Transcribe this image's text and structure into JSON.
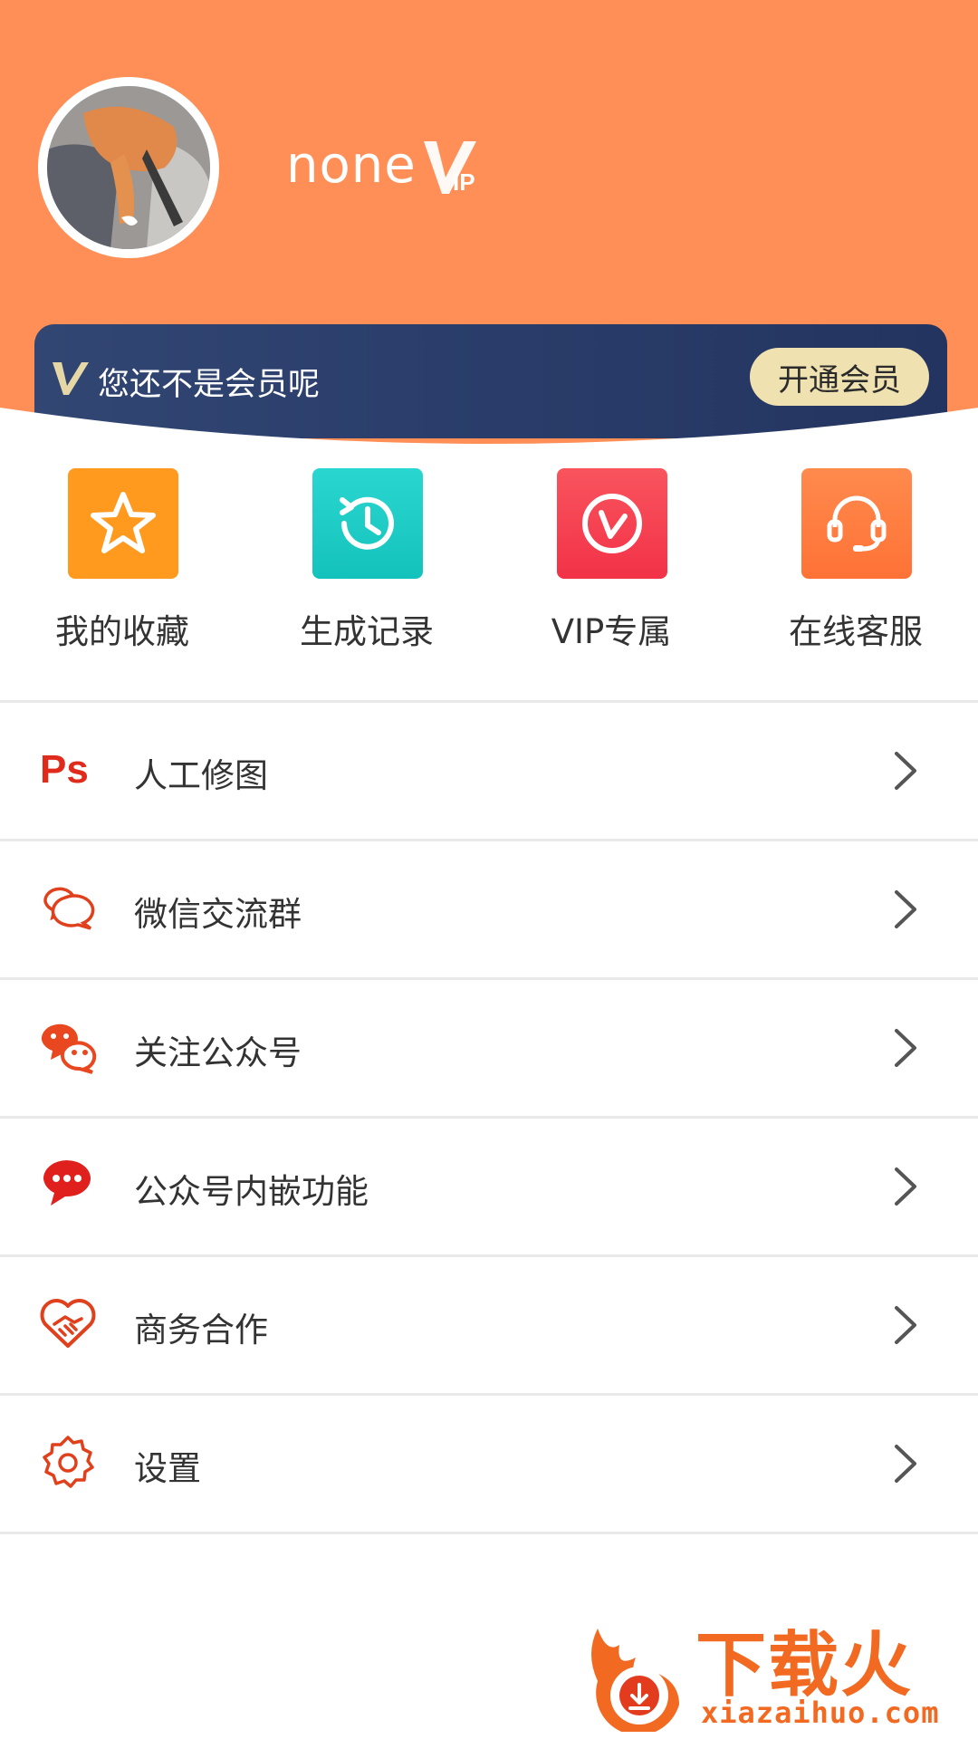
{
  "profile": {
    "username": "none",
    "vip_badge": "VIP"
  },
  "vip_banner": {
    "text": "您还不是会员呢",
    "button": "开通会员"
  },
  "quick_actions": [
    {
      "label": "我的收藏",
      "icon": "star-icon",
      "color": "#ff9a1f"
    },
    {
      "label": "生成记录",
      "icon": "history-icon",
      "color": "#1fcdc7"
    },
    {
      "label": "VIP专属",
      "icon": "vip-icon",
      "color": "#f93d55"
    },
    {
      "label": "在线客服",
      "icon": "headset-icon",
      "color": "#ff7c40"
    }
  ],
  "menu": [
    {
      "label": "人工修图",
      "icon": "ps-icon"
    },
    {
      "label": "微信交流群",
      "icon": "chat-bubbles-icon"
    },
    {
      "label": "关注公众号",
      "icon": "wechat-icon"
    },
    {
      "label": "公众号内嵌功能",
      "icon": "message-icon"
    },
    {
      "label": "商务合作",
      "icon": "handshake-icon"
    },
    {
      "label": "设置",
      "icon": "gear-icon"
    }
  ],
  "watermark": {
    "text": "下载火",
    "url": "xiazaihuo.com"
  },
  "colors": {
    "header": "#ff8f57",
    "banner": "#2a3d6a",
    "accent_red": "#e02b1c"
  }
}
